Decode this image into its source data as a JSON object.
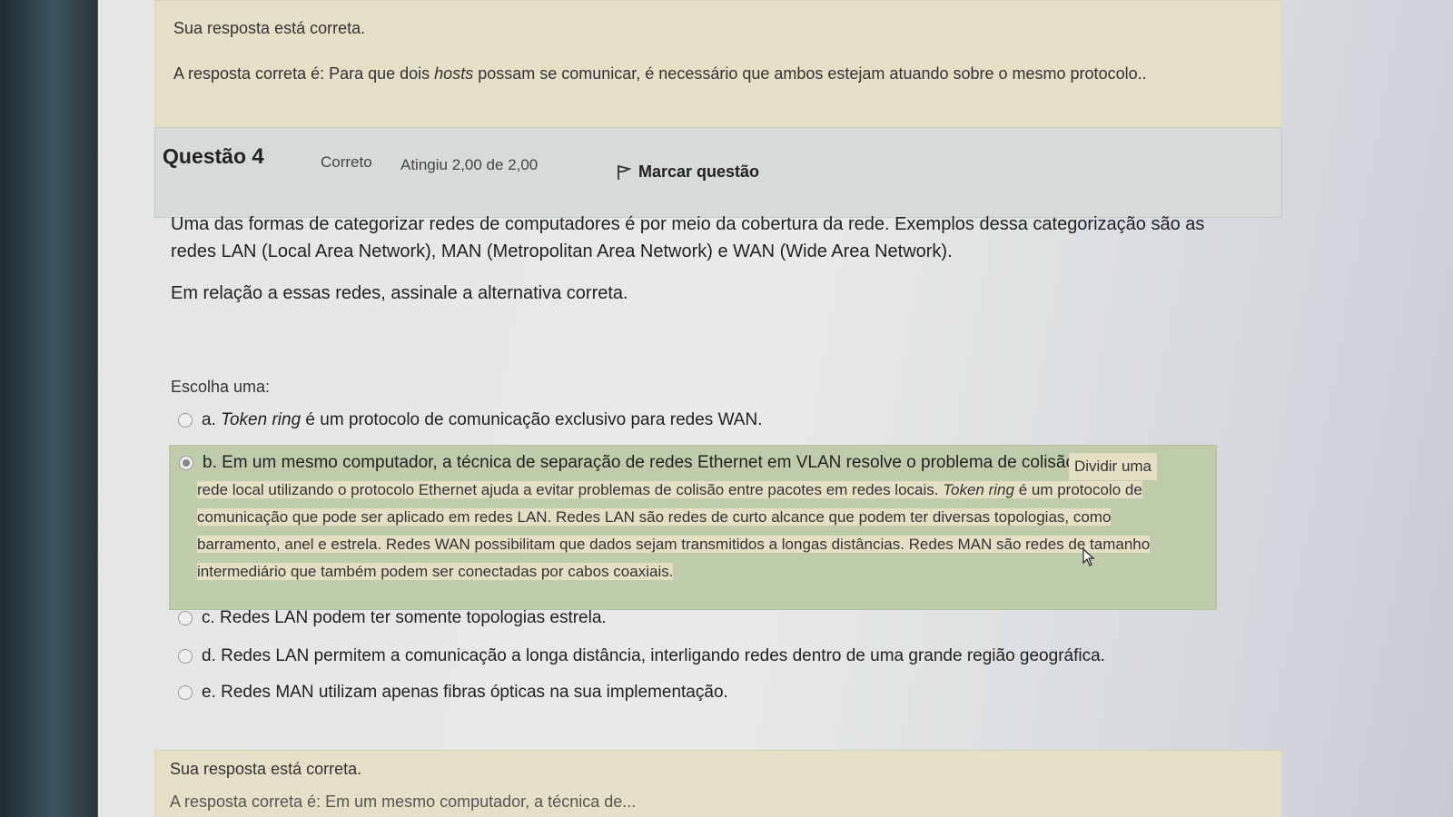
{
  "feedback_top": {
    "status": "Sua resposta está correta.",
    "answer_prefix": "A resposta correta é: Para que dois ",
    "answer_italic": "hosts",
    "answer_suffix": " possam se comunicar, é necessário que ambos estejam atuando sobre o mesmo protocolo.."
  },
  "question": {
    "title_word": "Questão",
    "number": "4",
    "state": "Correto",
    "grade": "Atingiu 2,00 de 2,00",
    "flag_label": "Marcar questão",
    "text1": "Uma das formas de categorizar redes de computadores é por meio da cobertura da rede. Exemplos dessa categorização são as redes LAN (Local Area Network), MAN (Metropolitan Area Network) e WAN (Wide Area Network).",
    "text2": "Em relação a essas redes, assinale a alternativa correta.",
    "choose_label": "Escolha uma:"
  },
  "options": {
    "a_prefix": "a. ",
    "a_italic": "Token ring",
    "a_suffix": " é um protocolo de comunicação exclusivo para redes WAN.",
    "b": "b. Em um mesmo computador, a técnica de separação de redes Ethernet em VLAN resolve o problema de colisão.",
    "c": "c. Redes LAN podem ter somente topologias estrela.",
    "d": "d. Redes LAN permitem a comunicação a longa distância, interligando redes dentro de uma grande região geográfica.",
    "e": "e. Redes MAN utilizam apenas fibras ópticas na sua implementação."
  },
  "specific_feedback": {
    "start": "Dividir uma",
    "part1": "rede local utilizando o protocolo Ethernet ajuda a evitar problemas de colisão entre pacotes em redes locais. ",
    "italic": "Token ring",
    "part2": " é um protocolo de comunicação que pode ser aplicado em redes LAN. Redes LAN são redes de curto alcance que podem ter diversas topologias, como barramento, anel e estrela. Redes WAN possibilitam que dados sejam transmitidos a longas distâncias. Redes MAN são redes de tamanho intermediário que também podem ser conectadas por cabos coaxiais."
  },
  "feedback_bottom": {
    "status": "Sua resposta está correta.",
    "answer_partial": "A resposta correta é: Em um mesmo computador, a técnica de..."
  },
  "icons": {
    "flag": "flag-icon",
    "check": "check-icon",
    "cursor": "cursor-icon"
  }
}
